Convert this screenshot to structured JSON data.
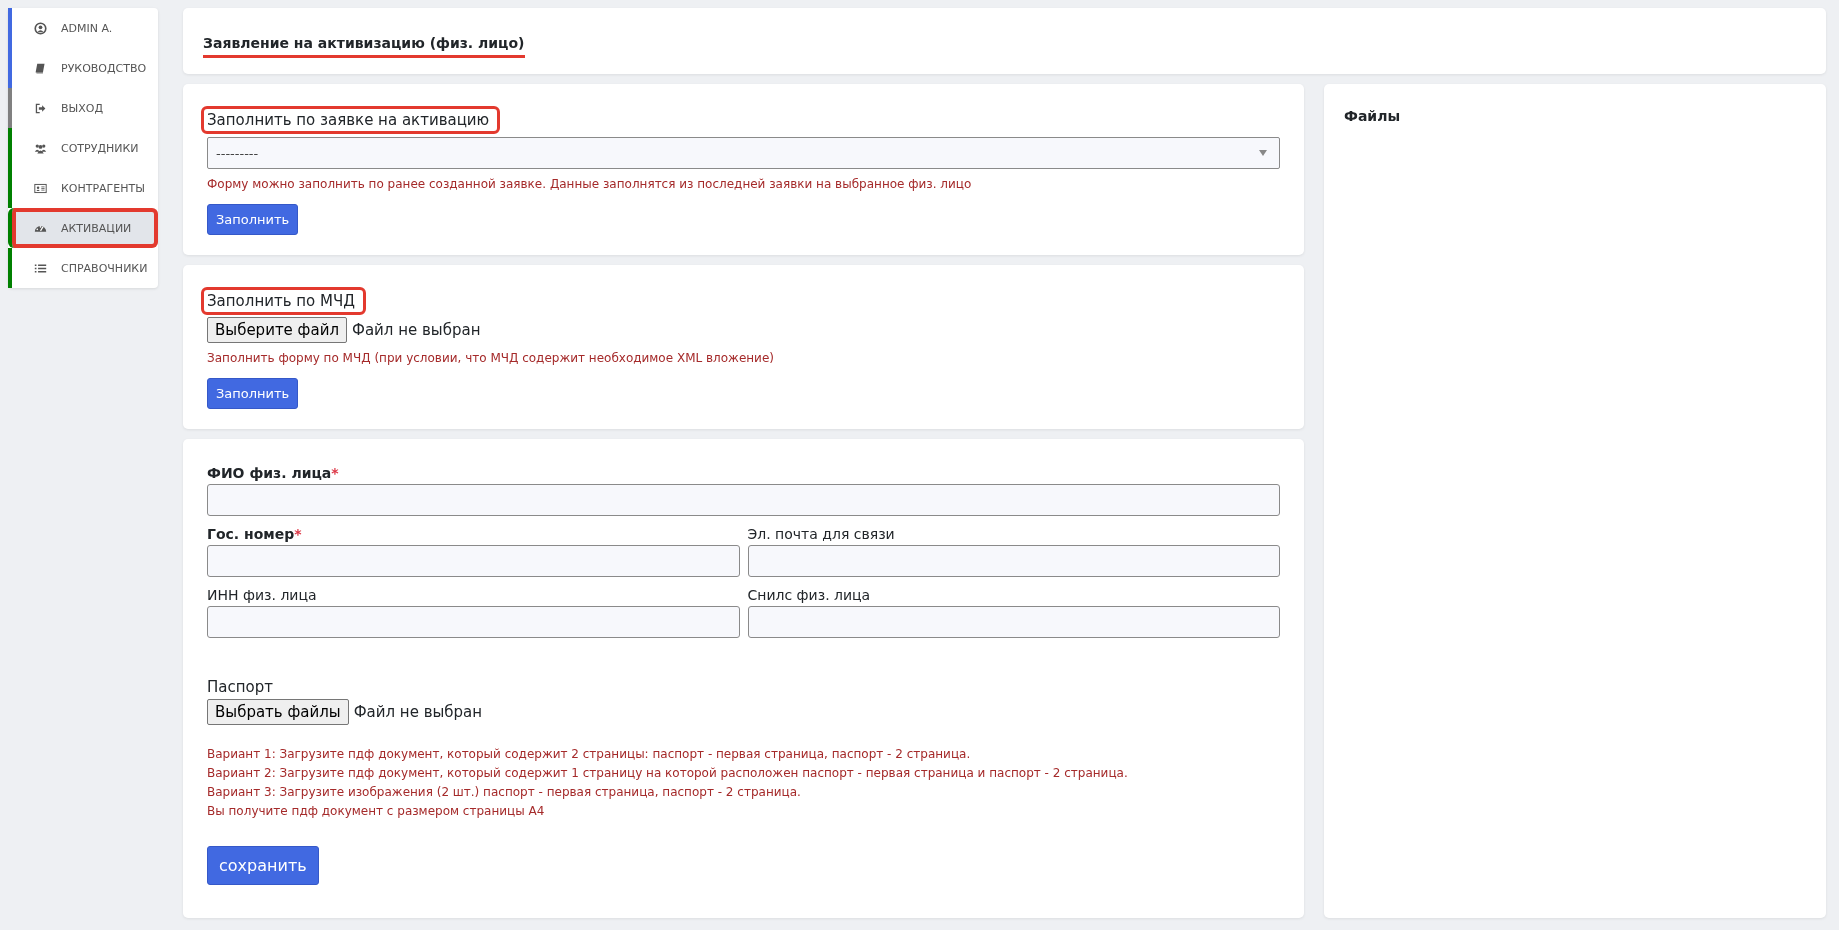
{
  "sidebar": {
    "items": [
      {
        "label": "ADMIN A.",
        "color": "#4169e1",
        "selected": false,
        "annotated": false
      },
      {
        "label": "РУКОВОДСТВО",
        "color": "#4169e1",
        "selected": false,
        "annotated": false
      },
      {
        "label": "ВЫХОД",
        "color": "#808080",
        "selected": false,
        "annotated": false
      },
      {
        "label": "СОТРУДНИКИ",
        "color": "#008000",
        "selected": false,
        "annotated": false
      },
      {
        "label": "КОНТРАГЕНТЫ",
        "color": "#008000",
        "selected": false,
        "annotated": false
      },
      {
        "label": "АКТИВАЦИИ",
        "color": "#008000",
        "selected": true,
        "annotated": true
      },
      {
        "label": "СПРАВОЧНИКИ",
        "color": "#008000",
        "selected": false,
        "annotated": false
      }
    ]
  },
  "header": {
    "title": "Заявление на активизацию (физ. лицо)",
    "annotated": true
  },
  "fill_by_request": {
    "label": "Заполнить по заявке на активацию",
    "annotated": true,
    "select": {
      "value": "---------"
    },
    "hint": "Форму можно заполнить по ранее созданной заявке. Данные заполнятся из последней заявки на выбранное физ. лицо",
    "button": "Заполнить"
  },
  "fill_by_mchd": {
    "label": "Заполнить по МЧД",
    "annotated": true,
    "file": {
      "button": "Выберите файл",
      "status": "Файл не выбран"
    },
    "hint": "Заполнить форму по МЧД (при условии, что МЧД содержит необходимое XML вложение)",
    "button": "Заполнить"
  },
  "form": {
    "required_mark": "*",
    "fields": [
      {
        "label": "ФИО физ. лица",
        "required": true,
        "kind": "full"
      },
      {
        "label": "Гос. номер",
        "required": true,
        "kind": "half"
      },
      {
        "label": "Эл. почта для связи",
        "required": false,
        "kind": "half"
      },
      {
        "label": "ИНН физ. лица",
        "required": false,
        "kind": "half"
      },
      {
        "label": "Снилс физ. лица",
        "required": false,
        "kind": "half"
      }
    ],
    "passport": {
      "label": "Паспорт",
      "file": {
        "button": "Выбрать файлы",
        "status": "Файл не выбран"
      }
    },
    "hints": [
      "Вариант 1: Загрузите пдф документ, который содержит 2 страницы: паспорт - первая страница, паспорт - 2 страница.",
      "Вариант 2: Загрузите пдф документ, который содержит 1 страницу на которой расположен паспорт - первая страница и паспорт - 2 страница.",
      "Вариант 3: Загрузите изображения (2 шт.) паспорт - первая страница, паспорт - 2 страница.",
      "Вы получите пдф документ с размером страницы А4"
    ],
    "save_button": "сохранить"
  },
  "files_panel": {
    "title": "Файлы"
  }
}
